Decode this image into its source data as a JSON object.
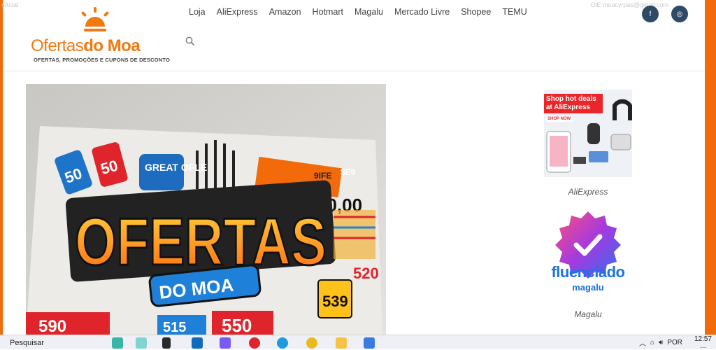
{
  "top_left_text": "sAcial",
  "top_right_text": "OlE moacyrpas@gmail.com",
  "logo": {
    "name_regular": "Ofertas",
    "name_bold": "do Moa",
    "tagline": "OFERTAS, PROMOÇÕES E CUPONS DE DESCONTO"
  },
  "nav": {
    "items": [
      "Loja",
      "AliExpress",
      "Amazon",
      "Hotmart",
      "Magalu",
      "Mercado Livre",
      "Shopee",
      "TEMU"
    ]
  },
  "social": {
    "facebook_icon": "facebook-icon",
    "instagram_icon": "instagram-icon"
  },
  "hero": {
    "title": "OFERTAS",
    "subtitle": "DO MOA",
    "tag1": "50",
    "tag2": "50",
    "badge": "GREAT OFLE",
    "price1": "50,00",
    "price2": "520",
    "price3": "539",
    "price4": "590",
    "price5": "550",
    "price6": "9IFE",
    "price7": "$E9",
    "price8": "515"
  },
  "sidebar": {
    "ali_ad": {
      "line1": "Shop hot deals",
      "line2": "at AliExpress",
      "cta": "SHOP NOW"
    },
    "ali_label": "AliExpress",
    "magalu_word1": "fluenciado",
    "magalu_word2": "magalu",
    "magalu_label": "Magalu"
  },
  "taskbar": {
    "search_placeholder": "Pesquisar",
    "language": "POR",
    "time": "12:57",
    "date": "..."
  },
  "colors": {
    "accent": "#f26a0a",
    "social": "#2f4a66"
  }
}
